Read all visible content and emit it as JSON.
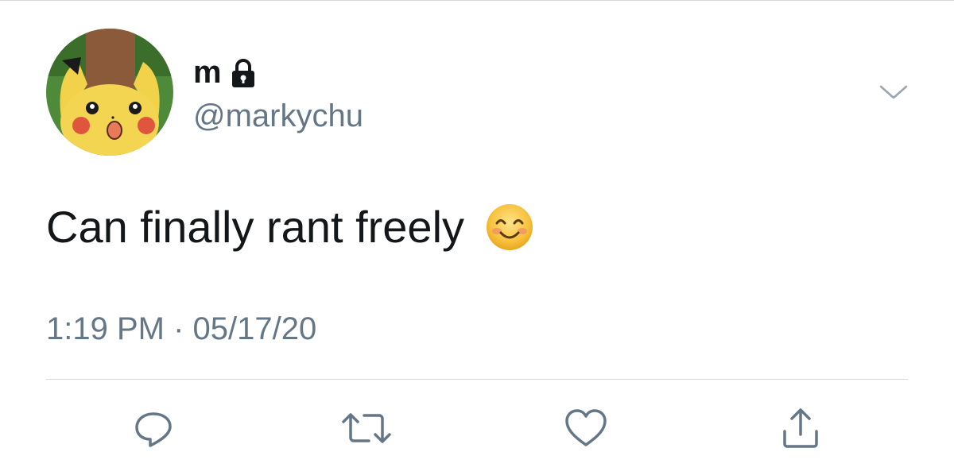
{
  "user": {
    "display_name": "m",
    "handle": "@markychu",
    "protected": true,
    "avatar_icon": "surprised-pikachu-avatar"
  },
  "tweet": {
    "text": "Can finally rant freely",
    "emoji": "smiling-face-with-smiling-eyes",
    "timestamp": "1:19 PM · 05/17/20"
  },
  "icons": {
    "lock": "lock-icon",
    "menu": "chevron-down-icon",
    "reply": "reply-icon",
    "retweet": "retweet-icon",
    "like": "heart-icon",
    "share": "share-icon"
  },
  "colors": {
    "primary_text": "#14171a",
    "secondary_text": "#657786",
    "icon": "#657786",
    "divider": "#d6d9dc"
  }
}
